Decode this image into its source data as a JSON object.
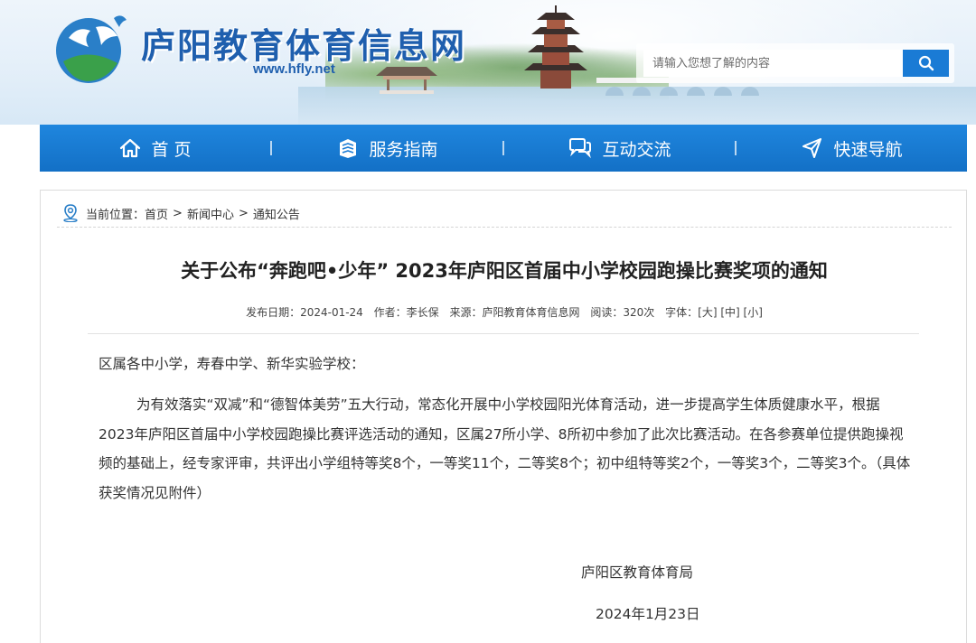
{
  "site": {
    "title": "庐阳教育体育信息网",
    "url": "www.hfly.net"
  },
  "search": {
    "placeholder": "请输入您想了解的内容"
  },
  "nav": {
    "items": [
      {
        "label": "首 页",
        "icon": "home-icon"
      },
      {
        "label": "服务指南",
        "icon": "book-icon"
      },
      {
        "label": "互动交流",
        "icon": "chat-icon"
      },
      {
        "label": "快速导航",
        "icon": "navigation-arrow-icon"
      }
    ]
  },
  "breadcrumb": {
    "prefix": "当前位置：",
    "items": [
      "首页",
      "新闻中心",
      "通知公告"
    ],
    "separator": ">"
  },
  "article": {
    "title": "关于公布“奔跑吧•少年” 2023年庐阳区首届中小学校园跑操比赛奖项的通知",
    "meta": {
      "date_label": "发布日期：",
      "date": "2024-01-24",
      "author_label": "作者：",
      "author": "李长保",
      "source_label": "来源：",
      "source": "庐阳教育体育信息网",
      "views_label": "阅读：",
      "views": "320次",
      "font_label": "字体：",
      "font_large": "[大]",
      "font_medium": "[中]",
      "font_small": "[小]"
    },
    "salutation": "区属各中小学，寿春中学、新华实验学校：",
    "paragraph": "为有效落实“双减”和“德智体美劳”五大行动，常态化开展中小学校园阳光体育活动，进一步提高学生体质健康水平，根据2023年庐阳区首届中小学校园跑操比赛评选活动的通知，区属27所小学、8所初中参加了此次比赛活动。在各参赛单位提供跑操视频的基础上，经专家评审，共评出小学组特等奖8个，一等奖11个，二等奖8个；初中组特等奖2个，一等奖3个，二等奖3个。（具体获奖情况见附件）",
    "signature_org": "庐阳区教育体育局",
    "signature_date": "2024年1月23日"
  },
  "colors": {
    "brand_blue": "#1f5fae",
    "nav_blue": "#1a7bd5",
    "text": "#333333"
  }
}
